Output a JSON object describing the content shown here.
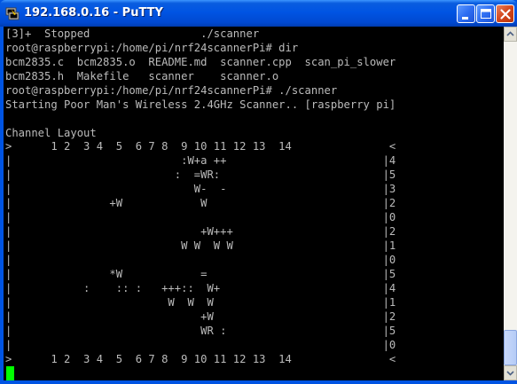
{
  "window": {
    "title": "192.168.0.16 - PuTTY",
    "icon": "putty-icon",
    "controls": [
      "minimize-icon",
      "maximize-icon",
      "close-icon"
    ]
  },
  "colors": {
    "terminal_background": "#000000",
    "terminal_text": "#bbbbbb",
    "cursor": "#00ff00",
    "titlebar": "#0054e3"
  },
  "terminal": {
    "lines": [
      "[3]+  Stopped                 ./scanner",
      "root@raspberrypi:/home/pi/nrf24scannerPi# dir",
      "bcm2835.c  bcm2835.o  README.md  scanner.cpp  scan_pi_slower",
      "bcm2835.h  Makefile   scanner    scanner.o",
      "root@raspberrypi:/home/pi/nrf24scannerPi# ./scanner",
      "Starting Poor Man's Wireless 2.4GHz Scanner.. [raspberry pi]",
      "",
      "Channel Layout",
      ">      1 2  3 4  5  6 7 8  9 10 11 12 13  14               <",
      "|                          :W+a ++                        |4",
      "|                         :  =WR:                         |5",
      "|                            W-  -                        |3",
      "|               +W            W                           |2",
      "|                                                         |0",
      "|                             +W+++                       |2",
      "|                          W W  W W                       |1",
      "|                                                         |0",
      "|               *W            =                           |5",
      "|           :    :: :   +++::  W+                         |4",
      "|                        W  W  W                          |1",
      "|                             +W                          |2",
      "|                             WR :                        |5",
      "|                                                         |0",
      ">      1 2  3 4  5  6 7 8  9 10 11 12 13  14               <"
    ]
  }
}
